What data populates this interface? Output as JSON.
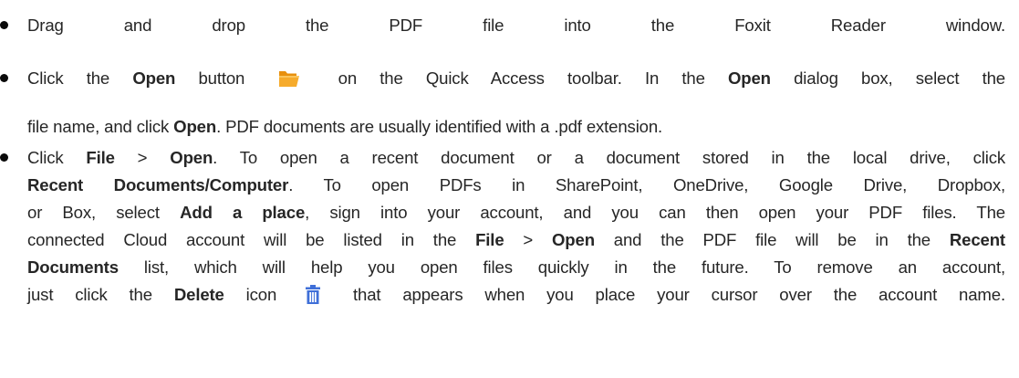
{
  "icons": {
    "open_button": "folder-open-icon",
    "delete_button": "trash-delete-icon"
  },
  "colors": {
    "text": "#262626",
    "folder_icon": "#f4a31c",
    "delete_icon": "#3f6fd8"
  },
  "items": [
    {
      "lines": [
        [
          {
            "t": "Drag and drop the PDF file into the Foxit Reader window."
          }
        ]
      ]
    },
    {
      "lines": [
        [
          {
            "t": "Click the "
          },
          {
            "t": "Open",
            "b": true
          },
          {
            "t": " button"
          },
          {
            "icon": "open"
          },
          {
            "t": "on the Quick Access toolbar. In the "
          },
          {
            "t": "Open",
            "b": true
          },
          {
            "t": " dialog box, select the"
          }
        ],
        [
          {
            "t": "file name, and click "
          },
          {
            "t": "Open",
            "b": true
          },
          {
            "t": ". PDF documents are usually identified with a .pdf extension."
          }
        ]
      ]
    },
    {
      "lines": [
        [
          {
            "t": "Click "
          },
          {
            "t": "File",
            "b": true
          },
          {
            "t": " > "
          },
          {
            "t": "Open",
            "b": true
          },
          {
            "t": ". To open a recent document or a document stored in the local drive, click"
          }
        ],
        [
          {
            "t": "Recent Documents/Computer",
            "b": true
          },
          {
            "t": ". To open PDFs in SharePoint, OneDrive, Google Drive, Dropbox,"
          }
        ],
        [
          {
            "t": "or Box, select "
          },
          {
            "t": "Add a place",
            "b": true
          },
          {
            "t": ", sign into your account, and you can then open your PDF files. The"
          }
        ],
        [
          {
            "t": "connected Cloud account will be listed in the "
          },
          {
            "t": "File",
            "b": true
          },
          {
            "t": " > "
          },
          {
            "t": "Open",
            "b": true
          },
          {
            "t": " and the PDF file will be in the "
          },
          {
            "t": "Recent",
            "b": true
          }
        ],
        [
          {
            "t": "Documents",
            "b": true
          },
          {
            "t": " list, which will help you open files quickly in the future. To remove an account,"
          }
        ],
        [
          {
            "t": "just click the "
          },
          {
            "t": "Delete",
            "b": true
          },
          {
            "t": " icon"
          },
          {
            "icon": "delete"
          },
          {
            "t": "that appears when you place your cursor over the account name."
          }
        ]
      ]
    }
  ]
}
